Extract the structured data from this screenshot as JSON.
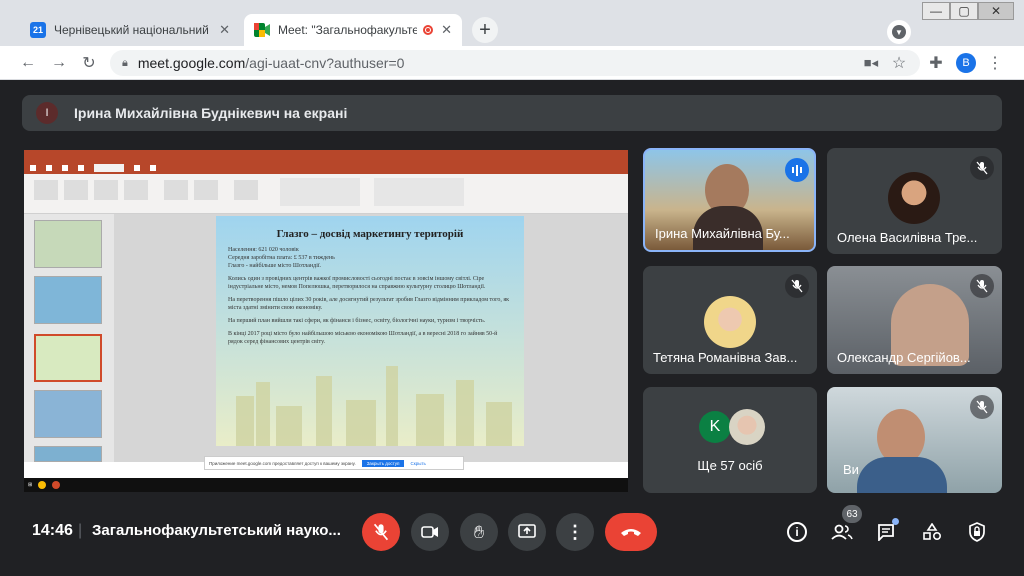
{
  "browser": {
    "tabs": [
      {
        "title": "Чернівецький національний ун",
        "favicon": "calendar-icon",
        "active": false
      },
      {
        "title": "Meet: \"Загальнофакультетсь",
        "favicon": "meet-icon",
        "active": true
      }
    ],
    "new_tab": "+",
    "url_host": "meet.google.com",
    "url_path": "/agi-uaat-cnv?authuser=0",
    "profile_initial": "B"
  },
  "meet": {
    "presenter_initial": "І",
    "presenter_banner": "Ірина Михайлівна Буднікевич на екрані",
    "slide": {
      "title": "Глазго – досвід маркетингу територій",
      "facts": [
        "Населення: 621 020 чоловік",
        "Середня заробітна плата: £ 537 в тиждень",
        "Глазго - найбільше місто Шотландії."
      ],
      "paragraphs": [
        "Колись один з провідних центрів важкої промисловості сьогодні постає в зовсім іншому світлі. Сіре індустріальне місто, немов Попелюшка, перетворилося на справжню культурну столицю Шотландії.",
        "На перетворення пішло цілих 30 років, але досягнутий результат зробив Глазго відмінним прикладом того, як міста здатні змінити свою економіку.",
        "На перший план вийшли такі сфери, як фінанси і бізнес, освіту, біологічні науки, туризм і творчість.",
        "В кінці 2017 році місто було найбільшою міською економікою Шотландії, а в вересні 2018 го зайняв 50-й рядок серед фінансових центрів світу."
      ],
      "notice_text": "Приложение meet.google.com предоставляет доступ к вашему экрану.",
      "notice_stop": "Закрыть доступ",
      "notice_hide": "Скрыть"
    },
    "participants": [
      {
        "name": "Ірина Михайлівна Бу...",
        "speaking": true
      },
      {
        "name": "Олена Василівна Тре...",
        "muted": true
      },
      {
        "name": "Тетяна Романівна Зав...",
        "muted": true
      },
      {
        "name": "Олександр Сергійов...",
        "muted": true
      },
      {
        "name": "Ще 57 осіб",
        "avatar_initial": "K"
      },
      {
        "name": "Ви",
        "muted": true
      }
    ],
    "time": "14:46",
    "meeting_title": "Загальнофакультетський науко...",
    "participants_count": "63",
    "colors": {
      "bg": "#202124",
      "tile": "#3c4043",
      "red": "#ea4335",
      "blue": "#1a73e8"
    }
  }
}
